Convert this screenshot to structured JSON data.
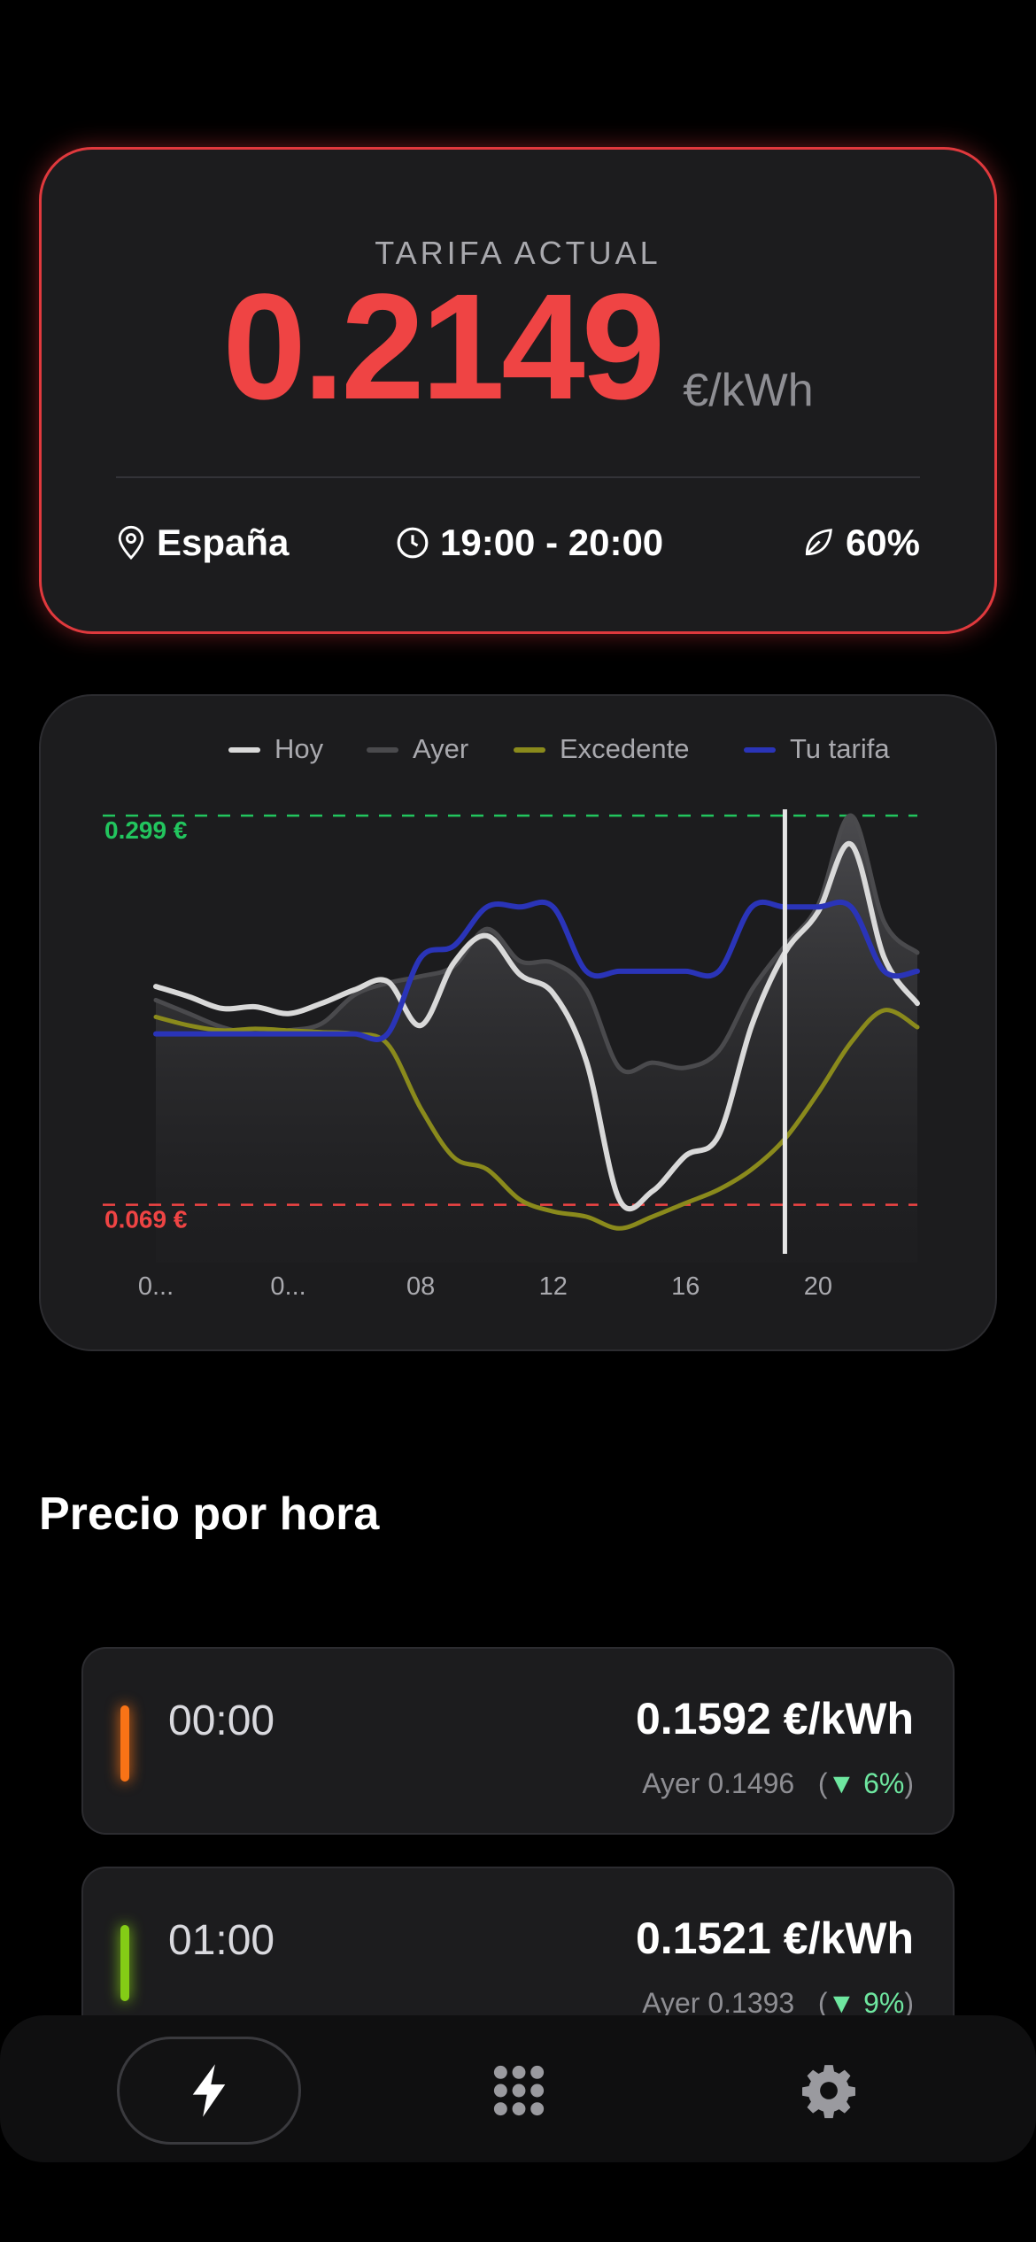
{
  "tariff": {
    "label": "TARIFA ACTUAL",
    "value": "0.2149",
    "unit": "€/kWh",
    "region": "España",
    "time_range": "19:00 - 20:00",
    "green_percent": "60%",
    "accent_color": "#ef4444"
  },
  "chart_data": {
    "type": "line",
    "legend": [
      {
        "name": "Hoy",
        "color": "#d9d9d9"
      },
      {
        "name": "Ayer",
        "color": "#4a4a4d"
      },
      {
        "name": "Excedente",
        "color": "#8a8a1c"
      },
      {
        "name": "Tu tarifa",
        "color": "#2a34b8"
      }
    ],
    "x_ticks": [
      "0...",
      "0...",
      "08",
      "12",
      "16",
      "20"
    ],
    "threshold_high": {
      "label": "0.299 €",
      "value": 0.299,
      "color": "#22c55e"
    },
    "threshold_low": {
      "label": "0.069 €",
      "value": 0.069,
      "color": "#ef4444"
    },
    "ylim": [
      0.04,
      0.32
    ],
    "xlim": [
      0,
      23
    ],
    "current_hour": 19,
    "x": [
      0,
      1,
      2,
      3,
      4,
      5,
      6,
      7,
      8,
      9,
      10,
      11,
      12,
      13,
      14,
      15,
      16,
      17,
      18,
      19,
      20,
      21,
      22,
      23
    ],
    "series": [
      {
        "name": "Hoy",
        "values": [
          0.198,
          0.192,
          0.185,
          0.186,
          0.182,
          0.188,
          0.196,
          0.201,
          0.175,
          0.212,
          0.228,
          0.205,
          0.194,
          0.154,
          0.072,
          0.077,
          0.098,
          0.11,
          0.175,
          0.218,
          0.242,
          0.282,
          0.215,
          0.188
        ]
      },
      {
        "name": "Ayer",
        "values": [
          0.19,
          0.182,
          0.174,
          0.17,
          0.172,
          0.176,
          0.193,
          0.2,
          0.204,
          0.21,
          0.232,
          0.213,
          0.212,
          0.196,
          0.15,
          0.153,
          0.15,
          0.16,
          0.196,
          0.222,
          0.246,
          0.299,
          0.236,
          0.218
        ]
      },
      {
        "name": "Excedente",
        "values": [
          0.18,
          0.175,
          0.172,
          0.173,
          0.172,
          0.171,
          0.17,
          0.164,
          0.126,
          0.097,
          0.09,
          0.072,
          0.065,
          0.062,
          0.055,
          0.062,
          0.07,
          0.078,
          0.09,
          0.108,
          0.135,
          0.165,
          0.184,
          0.174
        ]
      },
      {
        "name": "Tu tarifa",
        "values": [
          0.17,
          0.17,
          0.17,
          0.17,
          0.17,
          0.17,
          0.17,
          0.17,
          0.215,
          0.222,
          0.245,
          0.245,
          0.245,
          0.207,
          0.207,
          0.207,
          0.207,
          0.207,
          0.245,
          0.245,
          0.245,
          0.245,
          0.207,
          0.207
        ]
      }
    ]
  },
  "section_title": "Precio por hora",
  "hours": [
    {
      "time": "00:00",
      "price": "0.1592 €/kWh",
      "yesterday": "Ayer 0.1496",
      "delta": "▼ 6%",
      "indicator_color": "#f97316"
    },
    {
      "time": "01:00",
      "price": "0.1521 €/kWh",
      "yesterday": "Ayer 0.1393",
      "delta": "▼ 9%",
      "indicator_color": "#84cc16"
    }
  ],
  "tabbar": {
    "items": [
      {
        "icon": "bolt-icon",
        "active": true
      },
      {
        "icon": "grid-icon",
        "active": false
      },
      {
        "icon": "gear-icon",
        "active": false
      }
    ]
  }
}
